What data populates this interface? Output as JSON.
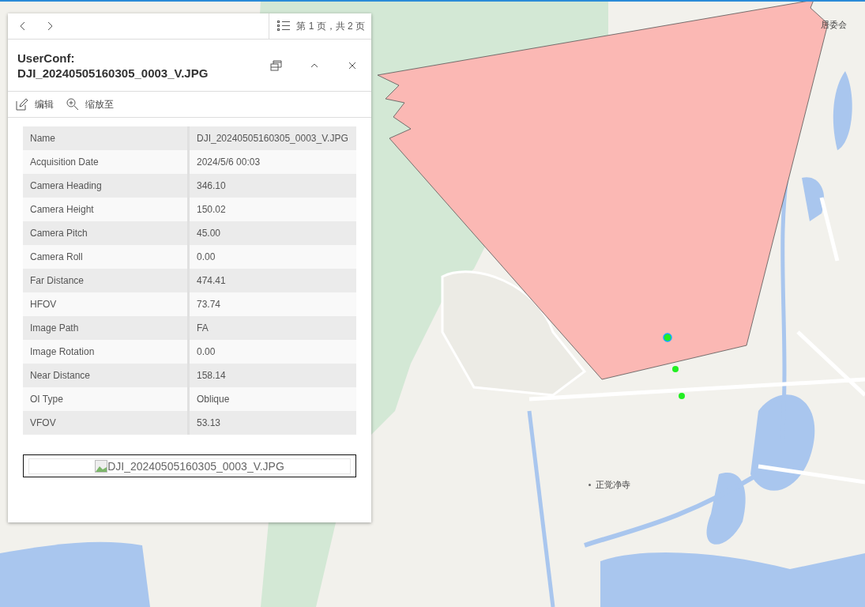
{
  "popup": {
    "pager": "第 1 页，共 2 页",
    "title": "UserConf: DJI_20240505160305_0003_V.JPG",
    "actions": [
      {
        "kind": "edit",
        "label": "编辑"
      },
      {
        "kind": "zoom",
        "label": "缩放至"
      }
    ],
    "fields": [
      {
        "label": "Name",
        "value": "DJI_20240505160305_0003_V.JPG"
      },
      {
        "label": "Acquisition Date",
        "value": "2024/5/6 00:03"
      },
      {
        "label": "Camera Heading",
        "value": "346.10"
      },
      {
        "label": "Camera Height",
        "value": "150.02"
      },
      {
        "label": "Camera Pitch",
        "value": "45.00"
      },
      {
        "label": "Camera Roll",
        "value": "0.00"
      },
      {
        "label": "Far Distance",
        "value": "474.41"
      },
      {
        "label": "HFOV",
        "value": "73.74"
      },
      {
        "label": "Image Path",
        "value": "FA"
      },
      {
        "label": "Image Rotation",
        "value": "0.00"
      },
      {
        "label": "Near Distance",
        "value": "158.14"
      },
      {
        "label": "OI Type",
        "value": "Oblique"
      },
      {
        "label": "VFOV",
        "value": "53.13"
      }
    ],
    "image_alt": "DJI_20240505160305_0003_V.JPG"
  },
  "map_labels": [
    {
      "text": "居委会",
      "dot": false
    },
    {
      "text": "正觉净寺",
      "dot": true
    }
  ]
}
